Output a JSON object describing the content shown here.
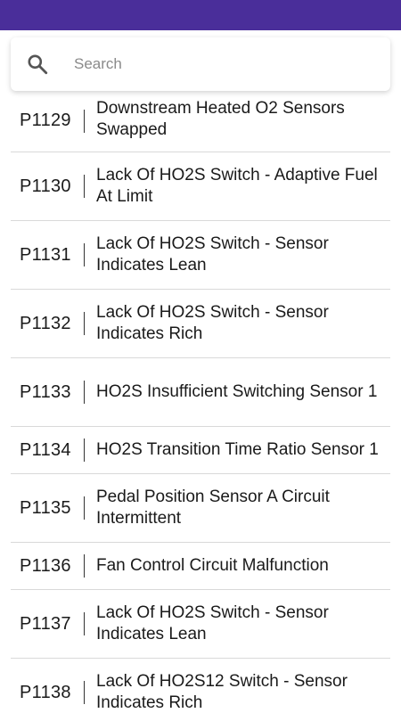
{
  "search": {
    "placeholder": "Search"
  },
  "codes": [
    {
      "code": "P1129",
      "description": "Downstream Heated O2 Sensors Swapped"
    },
    {
      "code": "P1130",
      "description": "Lack Of HO2S Switch - Adaptive Fuel At Limit"
    },
    {
      "code": "P1131",
      "description": "Lack Of HO2S Switch - Sensor Indicates Lean"
    },
    {
      "code": "P1132",
      "description": "Lack Of HO2S Switch - Sensor Indicates Rich"
    },
    {
      "code": "P1133",
      "description": "HO2S Insufficient Switching Sensor 1"
    },
    {
      "code": "P1134",
      "description": "HO2S Transition Time Ratio Sensor 1"
    },
    {
      "code": "P1135",
      "description": "Pedal Position Sensor A Circuit Intermittent"
    },
    {
      "code": "P1136",
      "description": "Fan Control Circuit Malfunction"
    },
    {
      "code": "P1137",
      "description": "Lack Of HO2S Switch - Sensor Indicates Lean"
    },
    {
      "code": "P1138",
      "description": "Lack Of HO2S12 Switch - Sensor Indicates Rich"
    }
  ],
  "colors": {
    "status_bar": "#4a2e9a"
  }
}
